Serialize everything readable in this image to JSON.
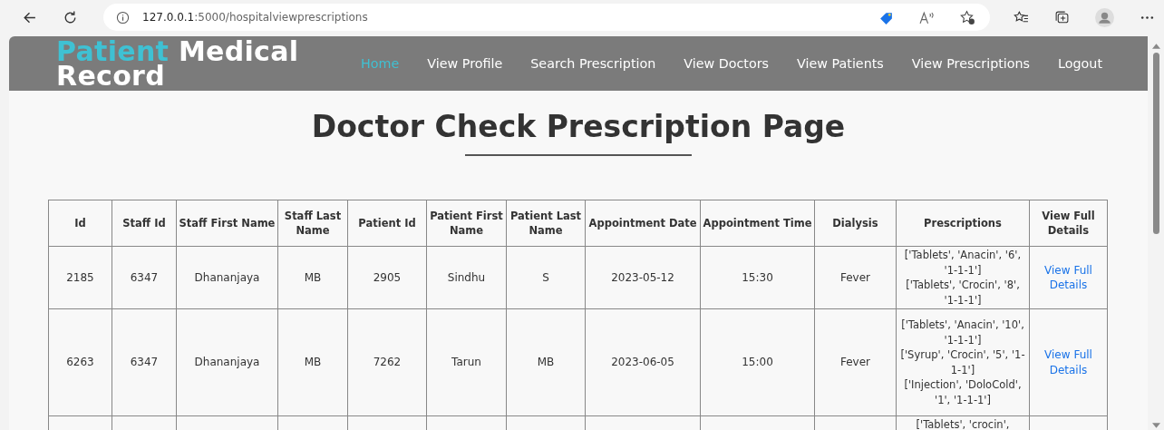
{
  "browser": {
    "url_host": "127.0.0.1",
    "url_path": ":5000/hospitalviewprescriptions"
  },
  "navbar": {
    "logo": {
      "highlight": "Patient",
      "rest": "Medical Record"
    },
    "links": [
      {
        "label": "Home",
        "selected": true
      },
      {
        "label": "View Profile",
        "selected": false
      },
      {
        "label": "Search Prescription",
        "selected": false
      },
      {
        "label": "View Doctors",
        "selected": false
      },
      {
        "label": "View Patients",
        "selected": false
      },
      {
        "label": "View Prescriptions",
        "selected": false
      },
      {
        "label": "Logout",
        "selected": false
      }
    ]
  },
  "page": {
    "title": "Doctor Check Prescription Page"
  },
  "table": {
    "columns": [
      "Id",
      "Staff Id",
      "Staff First Name",
      "Staff Last Name",
      "Patient Id",
      "Patient First Name",
      "Patient Last Name",
      "Appointment Date",
      "Appointment Time",
      "Dialysis",
      "Prescriptions",
      "View Full Details"
    ],
    "rows": [
      {
        "cells": [
          "2185",
          "6347",
          "Dhananjaya",
          "MB",
          "2905",
          "Sindhu",
          "S",
          "2023-05-12",
          "15:30",
          "Fever"
        ],
        "prescriptions": [
          "['Tablets', 'Anacin', '6', '1-1-1']",
          "['Tablets', 'Crocin', '8', '1-1-1']"
        ],
        "link": "View Full Details"
      },
      {
        "cells": [
          "6263",
          "6347",
          "Dhananjaya",
          "MB",
          "7262",
          "Tarun",
          "MB",
          "2023-06-05",
          "15:00",
          "Fever"
        ],
        "prescriptions": [
          "['Tablets', 'Anacin', '10', '1-1-1']",
          "['Syrup', 'Crocin', '5', '1-1-1']",
          "['Injection', 'DoloCold', '1', '1-1-1']"
        ],
        "link": "View Full Details"
      },
      {
        "cells": [],
        "prescriptions": [
          "['Tablets', 'crocin',"
        ]
      }
    ]
  }
}
